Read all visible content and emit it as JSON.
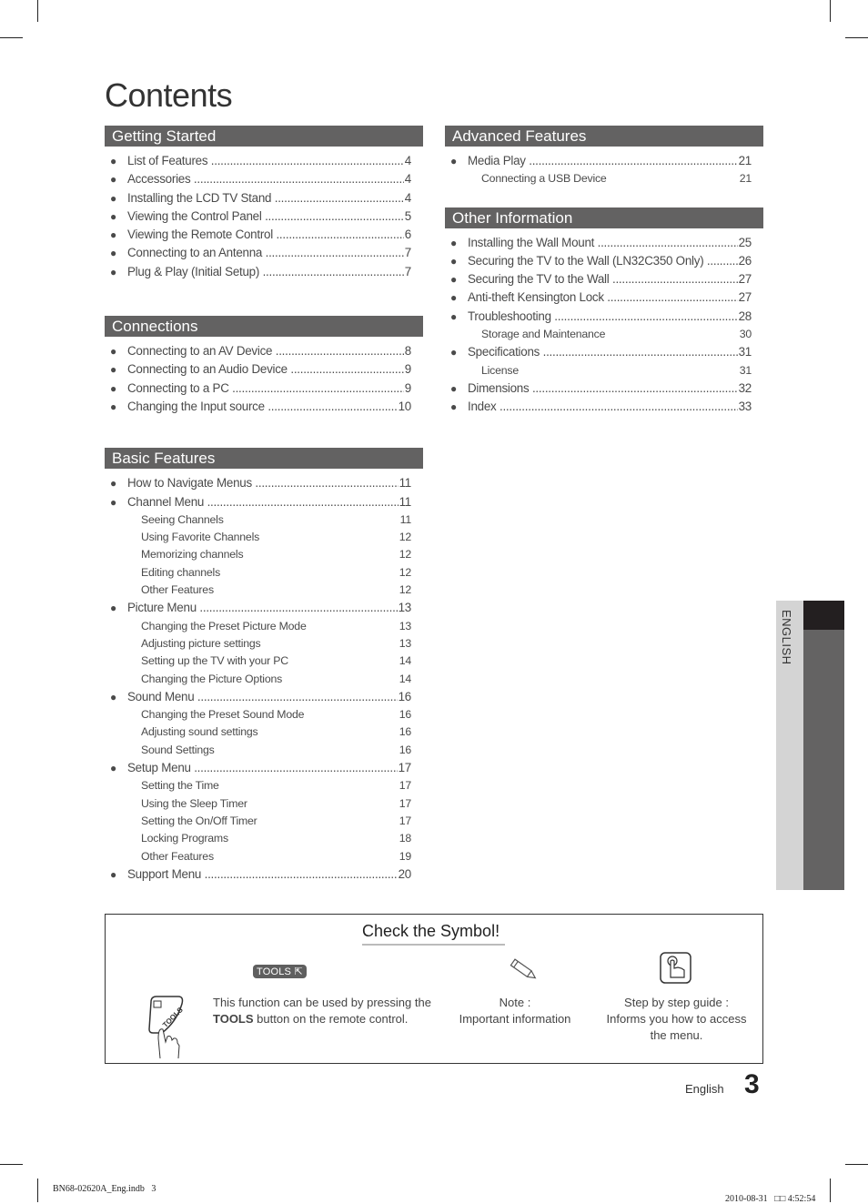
{
  "title": "Contents",
  "left_column": [
    {
      "heading": "Getting Started",
      "entries": [
        {
          "label": "List of Features",
          "page": "4"
        },
        {
          "label": "Accessories",
          "page": "4"
        },
        {
          "label": "Installing the LCD TV Stand",
          "page": "4"
        },
        {
          "label": "Viewing the Control Panel",
          "page": "5"
        },
        {
          "label": "Viewing the Remote Control",
          "page": "6"
        },
        {
          "label": "Connecting to an Antenna",
          "page": "7"
        },
        {
          "label": "Plug & Play (Initial Setup)",
          "page": "7"
        }
      ]
    },
    {
      "heading": "Connections",
      "entries": [
        {
          "label": "Connecting to an AV Device",
          "page": "8"
        },
        {
          "label": "Connecting to an Audio Device",
          "page": "9"
        },
        {
          "label": "Connecting to a PC",
          "page": "9"
        },
        {
          "label": "Changing the Input source",
          "page": "10"
        }
      ]
    },
    {
      "heading": "Basic Features",
      "entries": [
        {
          "label": "How to Navigate Menus",
          "page": "11"
        },
        {
          "label": "Channel Menu",
          "page": "11",
          "subs": [
            {
              "label": "Seeing Channels",
              "page": "11"
            },
            {
              "label": "Using Favorite Channels",
              "page": "12"
            },
            {
              "label": "Memorizing channels",
              "page": "12"
            },
            {
              "label": "Editing channels",
              "page": "12"
            },
            {
              "label": "Other Features",
              "page": "12"
            }
          ]
        },
        {
          "label": "Picture Menu",
          "page": "13",
          "subs": [
            {
              "label": "Changing the Preset Picture Mode",
              "page": "13"
            },
            {
              "label": "Adjusting picture settings",
              "page": "13"
            },
            {
              "label": "Setting up the TV with your PC",
              "page": "14"
            },
            {
              "label": "Changing the Picture Options",
              "page": "14"
            }
          ]
        },
        {
          "label": "Sound Menu",
          "page": "16",
          "subs": [
            {
              "label": "Changing the Preset Sound Mode",
              "page": "16"
            },
            {
              "label": "Adjusting sound settings",
              "page": "16"
            },
            {
              "label": "Sound Settings",
              "page": "16"
            }
          ]
        },
        {
          "label": "Setup Menu",
          "page": "17",
          "subs": [
            {
              "label": "Setting the Time",
              "page": "17"
            },
            {
              "label": "Using the Sleep Timer",
              "page": "17"
            },
            {
              "label": "Setting the On/Off Timer",
              "page": "17"
            },
            {
              "label": "Locking Programs",
              "page": "18"
            },
            {
              "label": "Other Features",
              "page": "19"
            }
          ]
        },
        {
          "label": "Support Menu",
          "page": "20"
        }
      ]
    }
  ],
  "right_column": [
    {
      "heading": "Advanced Features",
      "entries": [
        {
          "label": "Media Play",
          "page": "21",
          "subs": [
            {
              "label": "Connecting a USB Device",
              "page": "21"
            }
          ]
        }
      ]
    },
    {
      "heading": "Other Information",
      "entries": [
        {
          "label": "Installing the Wall Mount",
          "page": "25"
        },
        {
          "label": "Securing the TV to the Wall (LN32C350 Only)",
          "page": "26"
        },
        {
          "label": "Securing the TV to the Wall",
          "page": "27"
        },
        {
          "label": "Anti-theft Kensington Lock",
          "page": "27"
        },
        {
          "label": "Troubleshooting",
          "page": "28",
          "subs": [
            {
              "label": "Storage and Maintenance",
              "page": "30"
            }
          ]
        },
        {
          "label": "Specifications",
          "page": "31",
          "subs": [
            {
              "label": "License",
              "page": "31"
            }
          ]
        },
        {
          "label": "Dimensions",
          "page": "32"
        },
        {
          "label": "Index",
          "page": "33"
        }
      ]
    }
  ],
  "side_tab": "ENGLISH",
  "symbol_box": {
    "title": "Check the Symbol!",
    "tools_badge": "TOOLS",
    "tools_text_1": "This function can be used by pressing the",
    "tools_bold": "TOOLS",
    "tools_text_2": " button on the remote control.",
    "remote_button_label": "TOOLS",
    "note_line1": "Note :",
    "note_line2": "Important information",
    "guide_line1": "Step by step guide :",
    "guide_line2": "Informs you how to access",
    "guide_line3": "the menu.",
    "icons": [
      "tools-remote-icon",
      "tools-badge-icon",
      "pencil-note-icon",
      "hand-pointer-icon"
    ]
  },
  "footer": {
    "language": "English",
    "page_number": "3"
  },
  "slug": {
    "file": "BN68-02620A_Eng.indb   3",
    "date": "2010-08-31",
    "time_prefix": "□□",
    "time": "4:52:54"
  }
}
